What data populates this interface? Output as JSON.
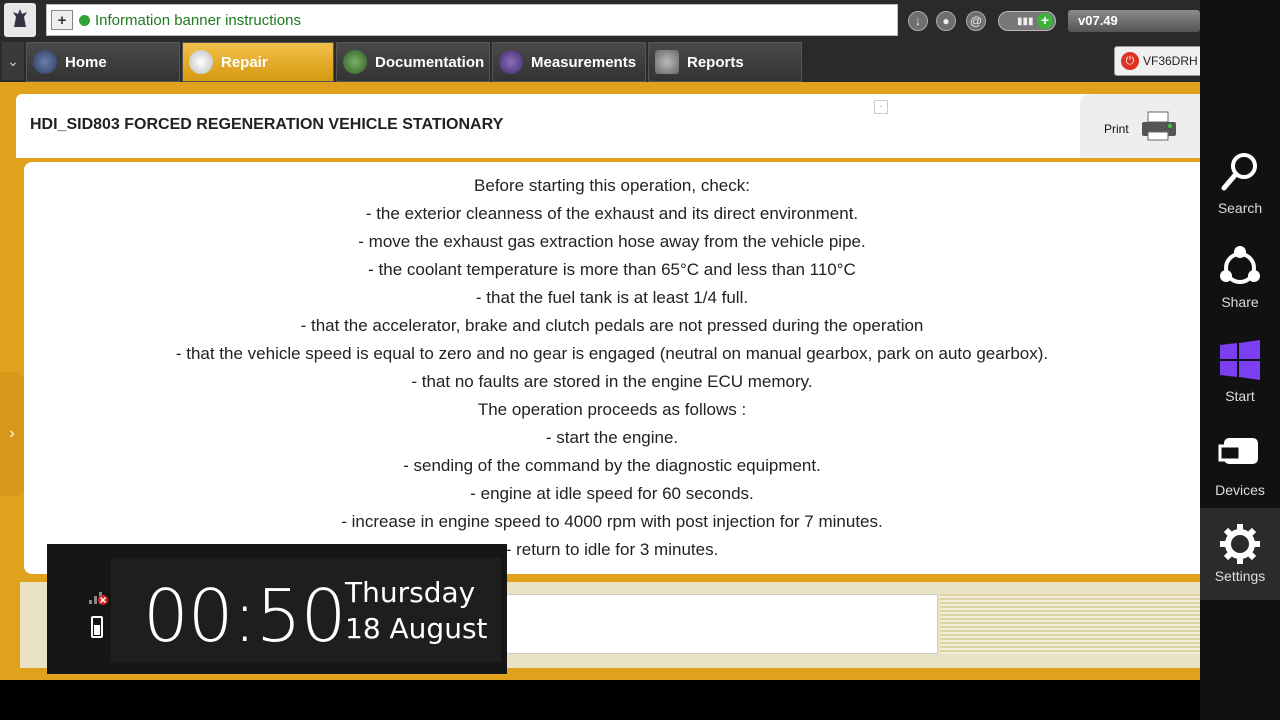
{
  "banner": {
    "text": "Information banner instructions"
  },
  "version": "v07.49",
  "logo_text": "PEUGEOT",
  "tabs": [
    {
      "label": "Home"
    },
    {
      "label": "Repair"
    },
    {
      "label": "Documentation"
    },
    {
      "label": "Measurements"
    },
    {
      "label": "Reports"
    }
  ],
  "vin": "VF36DRH",
  "page": {
    "title": "HDI_SID803  FORCED REGENERATION VEHICLE STATIONARY",
    "print_label": "Print"
  },
  "instructions": [
    "Before starting this operation, check:",
    "- the exterior cleanness of the exhaust and its direct environment.",
    "- move the exhaust gas extraction hose away from the vehicle pipe.",
    "- the coolant temperature is more than 65°C and less than 110°C",
    "- that the fuel tank is at least 1/4 full.",
    "- that the accelerator, brake and clutch pedals are not pressed during the operation",
    "- that the vehicle speed is equal to zero and no gear is engaged (neutral on manual gearbox, park on auto gearbox).",
    "- that no faults are stored in the engine ECU memory.",
    "The operation proceeds as follows :",
    "- start the engine.",
    "- sending of the command by the diagnostic equipment.",
    "- engine at idle speed for 60 seconds.",
    "- increase in engine speed to 4000 rpm with post injection for 7 minutes.",
    "- return to idle for 3 minutes."
  ],
  "clock": {
    "time": "00:50",
    "day": "Thursday",
    "date": "18 August"
  },
  "charms": [
    {
      "label": "Search",
      "icon": "search-icon"
    },
    {
      "label": "Share",
      "icon": "share-icon"
    },
    {
      "label": "Start",
      "icon": "windows-icon"
    },
    {
      "label": "Devices",
      "icon": "devices-icon"
    },
    {
      "label": "Settings",
      "icon": "gear-icon"
    }
  ],
  "colors": {
    "accent": "#e0a21d",
    "banner_text": "#1d7a1d",
    "tab_active": "#d69a10"
  }
}
